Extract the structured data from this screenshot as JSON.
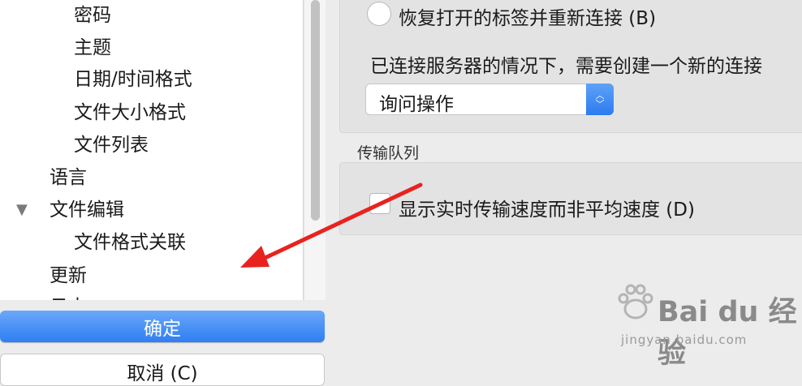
{
  "tree": {
    "items": [
      {
        "label": "密码"
      },
      {
        "label": "主题"
      },
      {
        "label": "日期/时间格式"
      },
      {
        "label": "文件大小格式"
      },
      {
        "label": "文件列表"
      },
      {
        "label": "语言"
      },
      {
        "label": "文件编辑"
      },
      {
        "label": "文件格式关联"
      },
      {
        "label": "更新"
      },
      {
        "label": "日志"
      }
    ]
  },
  "buttons": {
    "ok_label": "确定",
    "cancel_label": "取消 (C)"
  },
  "reconnect": {
    "radio_label": "恢复打开的标签并重新连接 (B)",
    "new_conn_text": "已连接服务器的情况下，需要创建一个新的连接",
    "select_value": "询问操作"
  },
  "queue": {
    "group_label": "传输队列",
    "checkbox_label": "显示实时传输速度而非平均速度 (D)"
  },
  "watermark": {
    "brand": "Bai du 经验",
    "url": "jingyan.baidu.com"
  },
  "colors": {
    "accent": "#2f7ef3",
    "arrow": "#e8231f"
  }
}
